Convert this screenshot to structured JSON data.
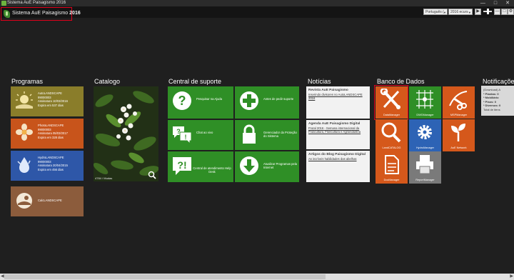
{
  "window": {
    "title": "Sistema AuE Paisagismo 2016"
  },
  "app": {
    "brand_name": "Sistema AuE Paisagismo",
    "brand_year": "2016"
  },
  "topbar": {
    "language": "Português (",
    "version": "2016 ecurs"
  },
  "sections": {
    "programas": "Programas",
    "catalogo": "Catalogo",
    "suporte": "Central de suporte",
    "noticias": "Notícias",
    "banco": "Banco de Dados",
    "notificacoes": "Notificações"
  },
  "programs": [
    {
      "line1": "AutoLANDSCAPE",
      "line2": "99000003",
      "line3": "Assinatura 10/03/2016",
      "line4": "Expira em 537 dias",
      "color": "#8a7d2a"
    },
    {
      "line1": "PhotoLANDSCAPE",
      "line2": "99000003",
      "line3": "Assinatura 05/03/2017",
      "line4": "Expira em 328 dias",
      "color": "#c8541b"
    },
    {
      "line1": "HydroLANDSCAPE",
      "line2": "99000003",
      "line3": "Assinatura 20/04/2015",
      "line4": "Expira em 456 dias",
      "color": "#2e57a8"
    },
    {
      "line1": "CalcLANDSCAPE",
      "line2": "",
      "line3": "",
      "line4": "",
      "color": "#8c5c3c"
    }
  ],
  "catalog": {
    "caption": "4784 / Mudas"
  },
  "support": [
    {
      "label": "Pesquisar na Ajuda",
      "icon": "question-icon"
    },
    {
      "label": "Antes de pedir suporte",
      "icon": "plus-icon"
    },
    {
      "label": "Chat ao vivo",
      "icon": "chat-icon"
    },
    {
      "label": "Gerenciador da Proteção do Sistema",
      "icon": "lock-icon"
    },
    {
      "label": "Central de atendimento Help Desk",
      "icon": "alert-icon"
    },
    {
      "label": "Atualizar Programas pela Internet",
      "icon": "download-icon"
    }
  ],
  "news": [
    {
      "title": "Revista AuE Paisagismo",
      "link": "Inserindo divisores no AutoLANDSCAPE 2016"
    },
    {
      "title": "Agenda AuE Paisagismo Digital",
      "link": "Frutal 2016 - Semana internacional da Fruticultura, Floricultura e Agroindústria"
    },
    {
      "title": "Artigos do Blog Paisagismo Digital",
      "link": "As incríveis habilidades das abelhas"
    }
  ],
  "databases": [
    {
      "label": "DataManager",
      "icon": "wrench-icon"
    },
    {
      "label": "DWGManager",
      "icon": "grid-icon"
    },
    {
      "label": "MSPManager",
      "icon": "pruning-icon"
    },
    {
      "label": "LandCATALOG",
      "icon": "magnifier-icon"
    },
    {
      "label": "HydroManager",
      "icon": "gear-icon"
    },
    {
      "label": "AuE Network",
      "icon": "sprout-icon"
    },
    {
      "label": "DocManager",
      "icon": "document-icon"
    },
    {
      "label": "ReportManager",
      "icon": "printer-icon"
    }
  ],
  "notifications": {
    "lines": [
      "(Download) A",
      "* Plantas: 0",
      "* Mobiliário",
      "* Pisos: 0",
      "* Diversos: 0",
      "Total de itens"
    ]
  },
  "colors": {
    "green": "#2f8f26",
    "orange": "#d5581b",
    "teal": "#0f8a93",
    "blue": "#2d63b5",
    "highlight": "#e0001b"
  }
}
